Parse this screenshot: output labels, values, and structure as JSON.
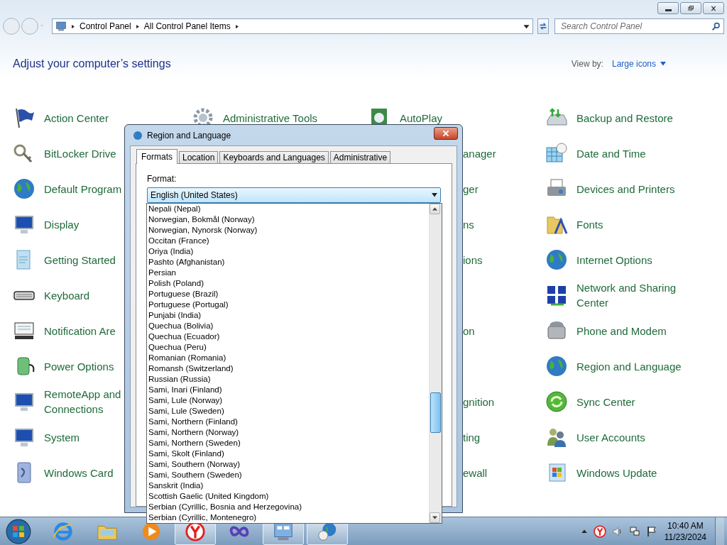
{
  "address_bar": {
    "breadcrumbs": [
      "Control Panel",
      "All Control Panel Items"
    ]
  },
  "search": {
    "placeholder": "Search Control Panel"
  },
  "header": {
    "title": "Adjust your computer’s settings",
    "view_by_label": "View by:",
    "view_by_value": "Large icons"
  },
  "rows": [
    {
      "column_1": {
        "kind": "item",
        "lines": [
          "Action Center"
        ]
      },
      "column_2": {
        "kind": "item",
        "lines": [
          "Administrative Tools"
        ]
      },
      "column_3": {
        "kind": "item",
        "lines": [
          "AutoPlay"
        ]
      },
      "column_4": {
        "kind": "item",
        "lines": [
          "Backup and Restore"
        ]
      }
    },
    {
      "column_1": {
        "kind": "item",
        "lines": [
          "BitLocker Drive"
        ]
      },
      "column_3": {
        "kind": "cut",
        "lines": [
          "anager"
        ]
      },
      "column_4": {
        "kind": "item",
        "lines": [
          "Date and Time"
        ]
      }
    },
    {
      "column_1": {
        "kind": "item",
        "lines": [
          "Default Program"
        ]
      },
      "column_3": {
        "kind": "cut",
        "lines": [
          "ger"
        ]
      },
      "column_4": {
        "kind": "item",
        "lines": [
          "Devices and Printers"
        ]
      }
    },
    {
      "column_1": {
        "kind": "item",
        "lines": [
          "Display"
        ]
      },
      "column_3": {
        "kind": "cut",
        "lines": [
          "ns"
        ]
      },
      "column_4": {
        "kind": "item",
        "lines": [
          "Fonts"
        ]
      }
    },
    {
      "column_1": {
        "kind": "item",
        "lines": [
          "Getting Started"
        ]
      },
      "column_3": {
        "kind": "cut",
        "lines": [
          "ions"
        ]
      },
      "column_4": {
        "kind": "item",
        "lines": [
          "Internet Options"
        ]
      }
    },
    {
      "column_1": {
        "kind": "item",
        "lines": [
          "Keyboard"
        ]
      },
      "column_4": {
        "kind": "item",
        "lines": [
          "Network and Sharing",
          "Center"
        ]
      }
    },
    {
      "column_1": {
        "kind": "item",
        "lines": [
          "Notification Are"
        ]
      },
      "column_3": {
        "kind": "cut",
        "lines": [
          "on"
        ]
      },
      "column_4": {
        "kind": "item",
        "lines": [
          "Phone and Modem"
        ]
      }
    },
    {
      "column_1": {
        "kind": "item",
        "lines": [
          "Power Options"
        ]
      },
      "column_4": {
        "kind": "item",
        "lines": [
          "Region and Language"
        ]
      }
    },
    {
      "column_1": {
        "kind": "item",
        "lines": [
          "RemoteApp and",
          "Connections"
        ]
      },
      "column_3": {
        "kind": "cut",
        "lines": [
          "gnition"
        ]
      },
      "column_4": {
        "kind": "item",
        "lines": [
          "Sync Center"
        ]
      }
    },
    {
      "column_1": {
        "kind": "item",
        "lines": [
          "System"
        ]
      },
      "column_3": {
        "kind": "cut",
        "lines": [
          "ting"
        ]
      },
      "column_4": {
        "kind": "item",
        "lines": [
          "User Accounts"
        ]
      }
    },
    {
      "column_1": {
        "kind": "item",
        "lines": [
          "Windows Card"
        ]
      },
      "column_3": {
        "kind": "cut",
        "lines": [
          "ewall"
        ]
      },
      "column_4": {
        "kind": "item",
        "lines": [
          "Windows Update"
        ]
      }
    }
  ],
  "dialog": {
    "title": "Region and Language",
    "tabs": [
      {
        "label": "Formats",
        "selected": true
      },
      {
        "label": "Location",
        "selected": false
      },
      {
        "label": "Keyboards and Languages",
        "selected": false
      },
      {
        "label": "Administrative",
        "selected": false
      }
    ],
    "format_label": "Format:",
    "format_value": "English (United States)",
    "options": [
      "Nepali (Nepal)",
      "Norwegian, Bokmål (Norway)",
      "Norwegian, Nynorsk (Norway)",
      "Occitan (France)",
      "Oriya (India)",
      "Pashto (Afghanistan)",
      "Persian",
      "Polish (Poland)",
      "Portuguese (Brazil)",
      "Portuguese (Portugal)",
      "Punjabi (India)",
      "Quechua (Bolivia)",
      "Quechua (Ecuador)",
      "Quechua (Peru)",
      "Romanian (Romania)",
      "Romansh (Switzerland)",
      "Russian (Russia)",
      "Sami, Inari (Finland)",
      "Sami, Lule (Norway)",
      "Sami, Lule (Sweden)",
      "Sami, Northern (Finland)",
      "Sami, Northern (Norway)",
      "Sami, Northern (Sweden)",
      "Sami, Skolt (Finland)",
      "Sami, Southern (Norway)",
      "Sami, Southern (Sweden)",
      "Sanskrit (India)",
      "Scottish Gaelic (United Kingdom)",
      "Serbian (Cyrillic, Bosnia and Herzegovina)",
      "Serbian (Cyrillic, Montenegro)"
    ]
  },
  "taskbar": {
    "apps": [
      {
        "kind": "browser",
        "running": false
      },
      {
        "kind": "folder",
        "running": false
      },
      {
        "kind": "media",
        "running": false
      },
      {
        "kind": "yandex",
        "running": true
      },
      {
        "kind": "infinity",
        "running": false
      },
      {
        "kind": "control-panel",
        "running": true
      },
      {
        "kind": "region",
        "running": true
      }
    ],
    "time": "10:40 AM",
    "date": "11/23/2024"
  }
}
